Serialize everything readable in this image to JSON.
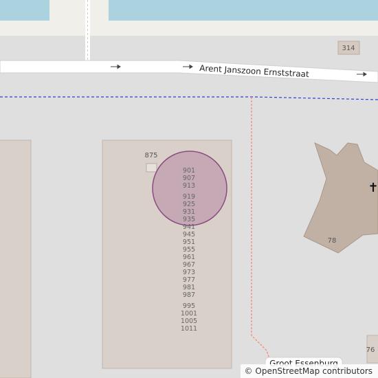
{
  "map": {
    "street_name": "Arent Janszoon Ernststraat",
    "street_name_bottom": "Groot Essenburg",
    "road_number": "314",
    "church_symbol": "✝",
    "building_numbers": {
      "left_top": "875",
      "church": "78",
      "bottom_right": "76"
    },
    "house_numbers": [
      "901",
      "907",
      "913",
      "919",
      "925",
      "931",
      "935",
      "941",
      "945",
      "951",
      "955",
      "961",
      "967",
      "973",
      "977",
      "981",
      "987",
      "995",
      "1001",
      "1005",
      "1011"
    ],
    "highlight_color": "#b58aa6",
    "water_color": "#aad3df",
    "building_color": "#d9d0c9",
    "church_color": "#c1b0a4",
    "boundary_color": "#2b3fd6",
    "path_color": "#fa8072"
  },
  "attribution": {
    "symbol": "©",
    "text": "OpenStreetMap contributors"
  }
}
